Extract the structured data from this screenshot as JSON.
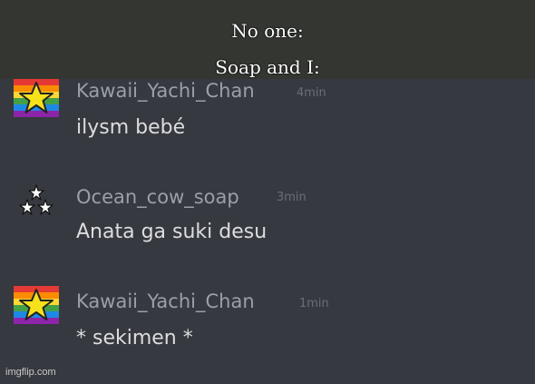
{
  "caption": {
    "line1": "No one:",
    "line2": "Soap and I:"
  },
  "messages": [
    {
      "username": "Kawaii_Yachi_Chan",
      "time": "4min",
      "text": "ilysm bebé",
      "avatar_icon": "rainbow-star-icon"
    },
    {
      "username": "Ocean_cow_soap",
      "time": "3min",
      "text": "Anata ga suki desu",
      "avatar_icon": "three-stars-icon"
    },
    {
      "username": "Kawaii_Yachi_Chan",
      "time": "1min",
      "text": "* sekimen *",
      "avatar_icon": "rainbow-star-icon"
    }
  ],
  "colors": {
    "background": "#36393f",
    "caption_band": "#343632",
    "username": "#9aa0a8",
    "message_text": "#dcddde",
    "timestamp": "#6b6f75",
    "star": "#f5e21b"
  },
  "watermark": "imgflip.com"
}
